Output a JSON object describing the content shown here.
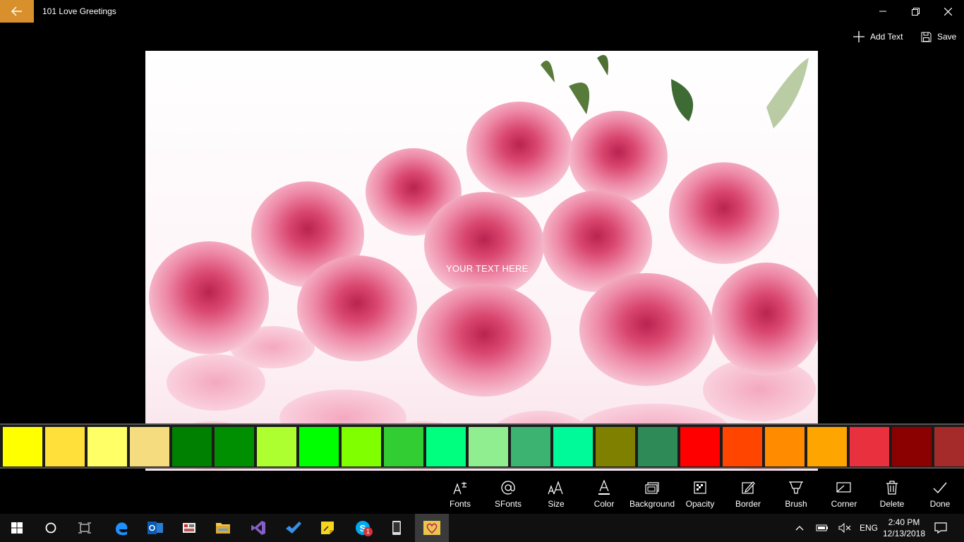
{
  "app": {
    "title": "101 Love Greetings"
  },
  "commands": {
    "add_text": "Add Text",
    "save": "Save"
  },
  "canvas": {
    "overlay_text": "YOUR TEXT HERE"
  },
  "palette": [
    "#ffff00",
    "#ffdf3a",
    "#ffff66",
    "#f5dc7f",
    "#008000",
    "#008f00",
    "#adff2f",
    "#00ff00",
    "#7fff00",
    "#32cd32",
    "#00ff7f",
    "#90ee90",
    "#3cb371",
    "#00fa9a",
    "#808000",
    "#2e8b57",
    "#ff0000",
    "#ff4500",
    "#ff8c00",
    "#ffa500",
    "#e8303e",
    "#8b0000",
    "#a52a2a"
  ],
  "tools": [
    {
      "label": "Fonts",
      "icon": "fonts-icon"
    },
    {
      "label": "SFonts",
      "icon": "at-sign-icon"
    },
    {
      "label": "Size",
      "icon": "font-size-icon"
    },
    {
      "label": "Color",
      "icon": "font-color-icon"
    },
    {
      "label": "Background",
      "icon": "background-icon"
    },
    {
      "label": "Opacity",
      "icon": "opacity-icon"
    },
    {
      "label": "Border",
      "icon": "border-icon"
    },
    {
      "label": "Brush",
      "icon": "brush-icon"
    },
    {
      "label": "Corner",
      "icon": "corner-icon"
    },
    {
      "label": "Delete",
      "icon": "trash-icon"
    },
    {
      "label": "Done",
      "icon": "checkmark-icon"
    }
  ],
  "taskbar": {
    "apps": [
      "start-icon",
      "cortana-icon",
      "task-view-icon",
      "edge-icon",
      "outlook-icon",
      "app-icon",
      "file-explorer-icon",
      "visual-studio-icon",
      "todo-icon",
      "sticky-notes-icon",
      "skype-icon",
      "phone-icon",
      "love-greetings-icon"
    ],
    "skype_badge": "1",
    "language": "ENG",
    "time": "2:40 PM",
    "date": "12/13/2018"
  },
  "colors": {
    "accent": "#d8902c"
  }
}
